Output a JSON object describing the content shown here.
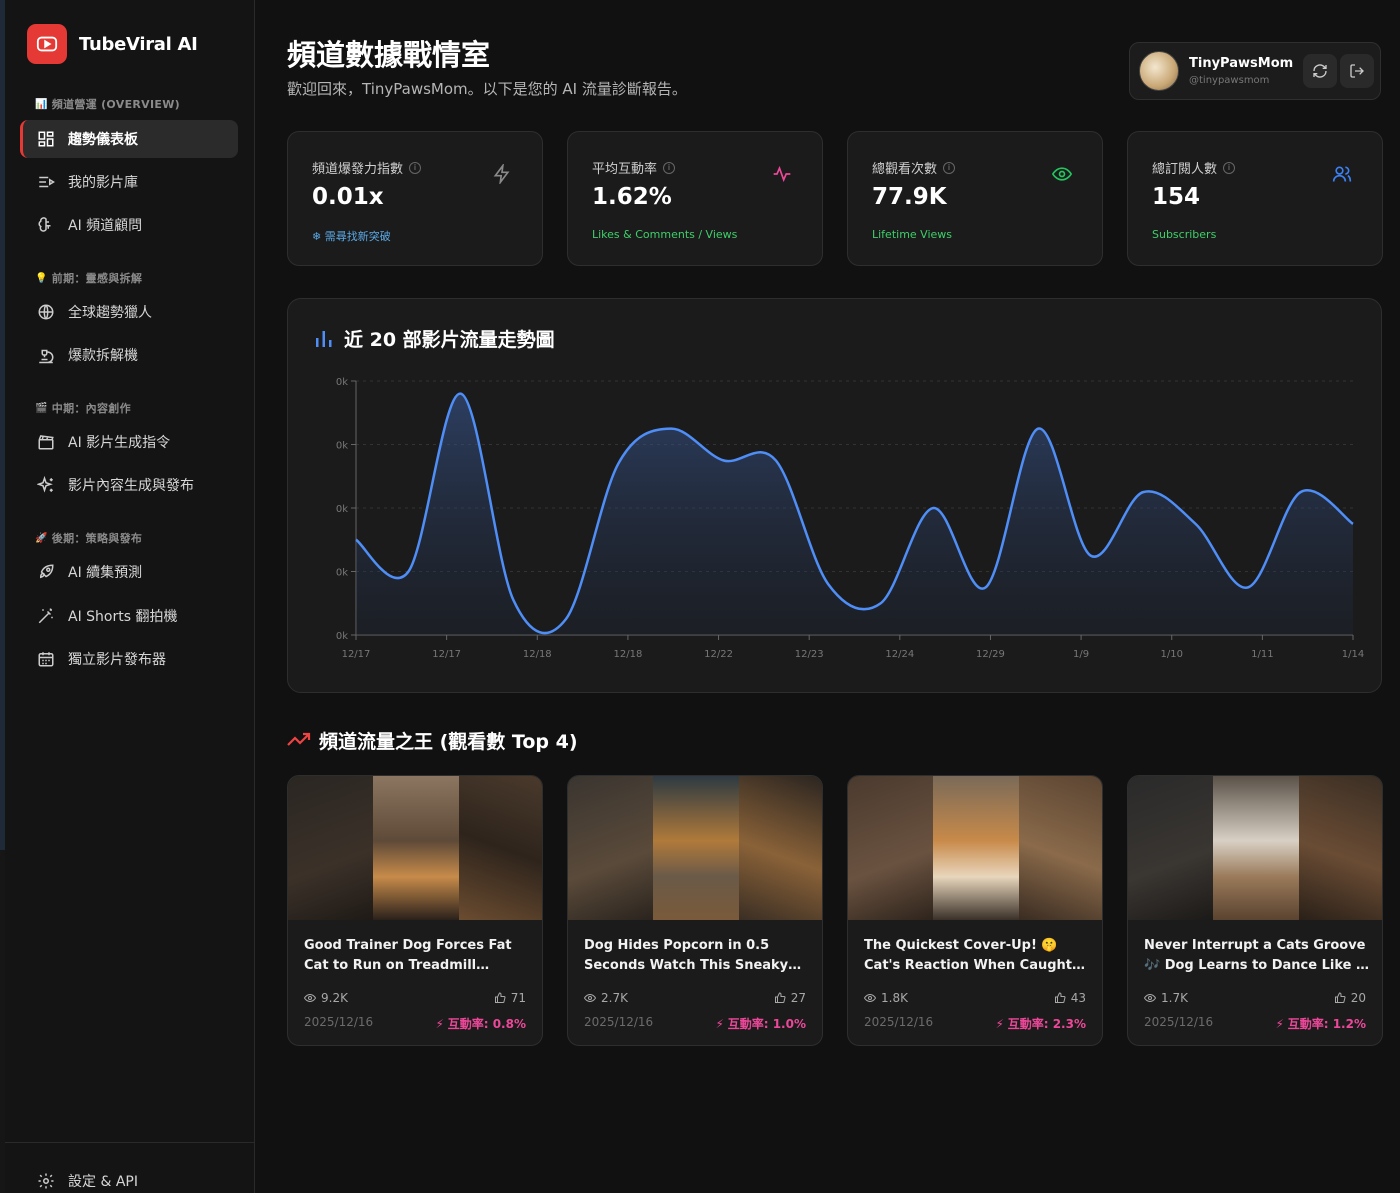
{
  "brand": {
    "name": "TubeViral AI"
  },
  "sidebar": {
    "sections": [
      {
        "emoji": "📊",
        "title": "頻道營運 (OVERVIEW)"
      },
      {
        "emoji": "💡",
        "title": "前期：靈感與拆解"
      },
      {
        "emoji": "🎬",
        "title": "中期：內容創作"
      },
      {
        "emoji": "🚀",
        "title": "後期：策略與發布"
      }
    ],
    "items": [
      {
        "label": "趨勢儀表板",
        "icon": "dashboard-icon"
      },
      {
        "label": "我的影片庫",
        "icon": "list-video-icon"
      },
      {
        "label": "AI 頻道顧問",
        "icon": "brain-icon"
      },
      {
        "label": "全球趨勢獵人",
        "icon": "globe-icon"
      },
      {
        "label": "爆款拆解機",
        "icon": "microscope-icon"
      },
      {
        "label": "AI 影片生成指令",
        "icon": "clapperboard-icon"
      },
      {
        "label": "影片內容生成與發布",
        "icon": "sparkles-icon"
      },
      {
        "label": "AI 續集預測",
        "icon": "rocket-icon"
      },
      {
        "label": "AI Shorts 翻拍機",
        "icon": "wand-icon"
      },
      {
        "label": "獨立影片發布器",
        "icon": "calendar-icon"
      }
    ],
    "footer": {
      "label": "設定 & API",
      "icon": "gear-icon"
    }
  },
  "header": {
    "title": "頻道數據戰情室",
    "subtitle": "歡迎回來，TinyPawsMom。以下是您的 AI 流量診斷報告。"
  },
  "user": {
    "name": "TinyPawsMom",
    "handle": "@tinypawsmom"
  },
  "stats": [
    {
      "label": "頻道爆發力指數",
      "value": "0.01x",
      "note": "❄ 需尋找新突破",
      "icon": "zap-icon",
      "accent": "#8a8a8a",
      "note_color": "#3ecf6b"
    },
    {
      "label": "平均互動率",
      "value": "1.62%",
      "note": "Likes & Comments / Views",
      "icon": "activity-icon",
      "accent": "#ec4899",
      "note_color": "#3ecf6b"
    },
    {
      "label": "總觀看次數",
      "value": "77.9K",
      "note": "Lifetime Views",
      "icon": "eye-icon",
      "accent": "#22c55e",
      "note_color": "#3ecf6b"
    },
    {
      "label": "總訂閱人數",
      "value": "154",
      "note": "Subscribers",
      "icon": "users-icon",
      "accent": "#3b82f6",
      "note_color": "#3ecf6b"
    }
  ],
  "chart": {
    "title": "近 20 部影片流量走勢圖",
    "icon": "bar-chart-icon"
  },
  "chart_data": {
    "type": "area",
    "title": "近 20 部影片流量走勢圖",
    "x": [
      "12/17",
      "12/17",
      "12/18",
      "12/18",
      "12/22",
      "12/23",
      "12/24",
      "12/29",
      "1/9",
      "1/10",
      "1/11",
      "1/14"
    ],
    "x_ticks": [
      "12/17",
      "12/17",
      "12/18",
      "12/18",
      "12/22",
      "12/23",
      "12/24",
      "12/29",
      "1/9",
      "1/10",
      "1/11",
      "1/14"
    ],
    "y_ticks": [
      "0k",
      "0k",
      "0k",
      "0k",
      "0k"
    ],
    "series": [
      {
        "values": [
          1.5,
          1.0,
          3.8,
          0.55,
          0.25,
          2.7,
          3.25,
          2.75,
          2.75,
          0.8,
          0.5,
          2.0,
          0.75,
          3.25,
          1.25,
          2.25,
          1.75,
          0.75,
          2.25,
          1.75
        ]
      }
    ],
    "ylim": [
      0,
      4
    ],
    "grid": true,
    "color": "#4f8ef7"
  },
  "top": {
    "title": "頻道流量之王 (觀看數 Top 4)",
    "icon": "trending-up-icon",
    "videos": [
      {
        "title": "Good Trainer Dog Forces Fat Cat to Run on Treadmill Challenge... #pets #funny #training",
        "views": "9.2K",
        "likes": "71",
        "date": "2025/12/16",
        "engagement": "互動率: 0.8%"
      },
      {
        "title": "Dog Hides Popcorn in 0.5 Seconds Watch This Sneaky Trick #meme #funny #pets",
        "views": "2.7K",
        "likes": "27",
        "date": "2025/12/16",
        "engagement": "互動率: 1.0%"
      },
      {
        "title": "The Quickest Cover-Up! 🤫 Cat's Reaction When Caught Stealing Food #funnycat #catreaction",
        "views": "1.8K",
        "likes": "43",
        "date": "2025/12/16",
        "engagement": "互動率: 2.3%"
      },
      {
        "title": "Never Interrupt a Cats Groove 🎶 Dog Learns to Dance Like a Pro... #cats #dogs #funny",
        "views": "1.7K",
        "likes": "20",
        "date": "2025/12/16",
        "engagement": "互動率: 1.2%"
      }
    ]
  }
}
